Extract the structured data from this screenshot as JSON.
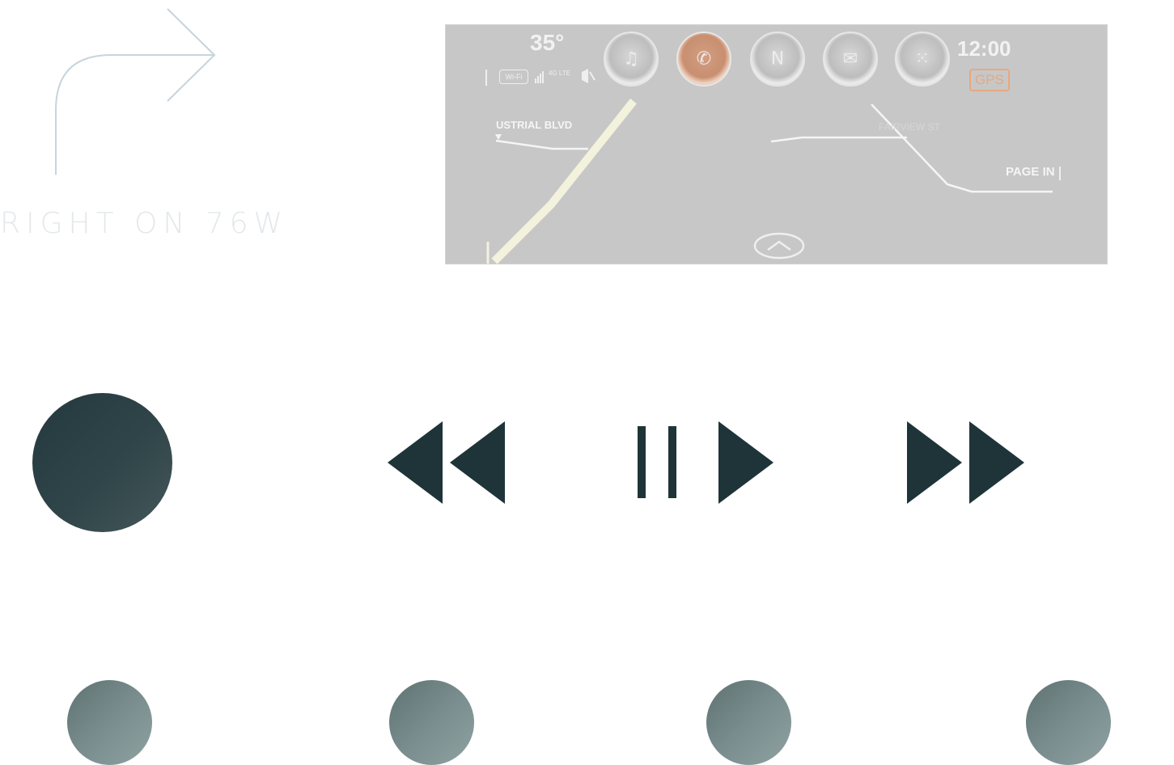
{
  "navigation": {
    "turn_instruction": "RIGHT ON 76W"
  },
  "nav_screen": {
    "temperature": "35°",
    "clock": "12:00",
    "gps_label": "GPS",
    "wifi_label": "Wi-Fi",
    "network_label": "4G LTE",
    "streets": {
      "left": "USTRIAL BLVD",
      "middle": "FAIRVIEW ST",
      "right": "PAGE IN"
    },
    "apps": [
      {
        "name": "music-app",
        "glyph": "♫",
        "accent": false
      },
      {
        "name": "phone-app",
        "glyph": "✆",
        "accent": true
      },
      {
        "name": "compass-app",
        "glyph": "N",
        "accent": false
      },
      {
        "name": "messages-app",
        "glyph": "✉",
        "accent": false
      },
      {
        "name": "dialpad-app",
        "glyph": "⁙",
        "accent": false
      }
    ],
    "colors": {
      "screen_bg": "#c7c7c7",
      "route_highlight": "#f3f2dc",
      "gps_accent": "#e7a87f"
    }
  },
  "controls": {
    "icons": [
      "stop-icon",
      "rewind-icon",
      "pause-icon",
      "play-icon",
      "fast-forward-icon"
    ],
    "color": "#1e3439"
  },
  "pagination": {
    "dots": 4
  },
  "colors": {
    "background": "#ffffff",
    "turn_text": "#e3e8ea",
    "stop_tile": "#919f9f",
    "control_dark": "#1e3439",
    "dot_gradient_start": "#5f7272",
    "dot_gradient_end": "#8fa2a2"
  }
}
